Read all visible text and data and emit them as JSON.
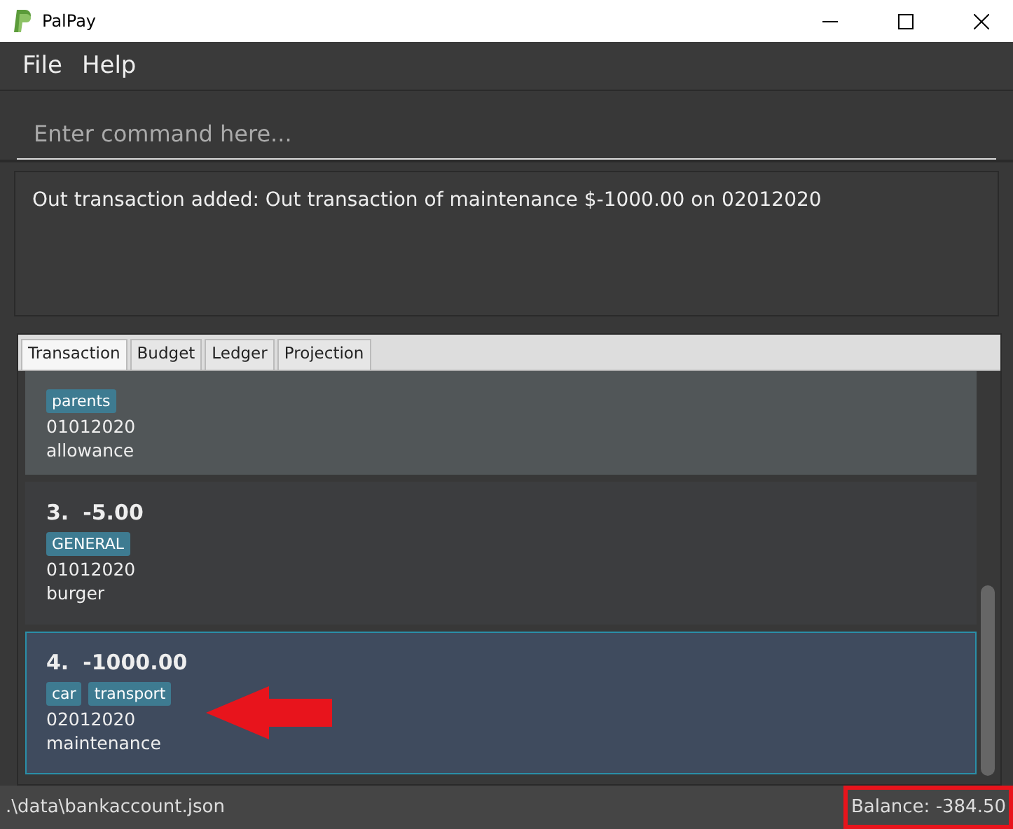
{
  "window": {
    "title": "PalPay"
  },
  "menu": [
    "File",
    "Help"
  ],
  "command": {
    "placeholder": "Enter command here..."
  },
  "result": "Out transaction added: Out transaction of maintenance $-1000.00 on 02012020",
  "tabs": [
    {
      "label": "Transaction",
      "selected": true
    },
    {
      "label": "Budget",
      "selected": false
    },
    {
      "label": "Ledger",
      "selected": false
    },
    {
      "label": "Projection",
      "selected": false
    }
  ],
  "transactions": [
    {
      "tags": [
        "parents"
      ],
      "date": "01012020",
      "description": "allowance",
      "selected": false,
      "kind": "clipped"
    },
    {
      "index": "3.",
      "amount": "-5.00",
      "tags": [
        "GENERAL"
      ],
      "date": "01012020",
      "description": "burger",
      "selected": false,
      "kind": "full"
    },
    {
      "index": "4.",
      "amount": "-1000.00",
      "tags": [
        "car",
        "transport"
      ],
      "date": "02012020",
      "description": "maintenance",
      "selected": true,
      "kind": "full"
    }
  ],
  "status_bar": {
    "path": ".\\data\\bankaccount.json",
    "balance": "Balance: -384.50"
  }
}
